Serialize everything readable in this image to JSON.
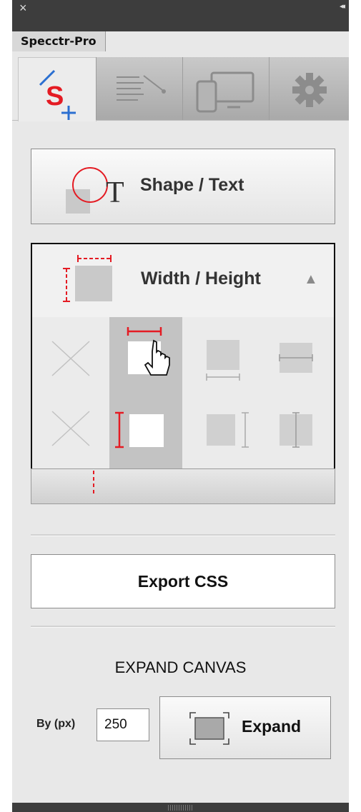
{
  "window": {
    "close_glyph": "×",
    "collapse_glyph": "◂◂"
  },
  "panel": {
    "tab_title": "Specctr-Pro"
  },
  "tabs": [
    {
      "name": "specs",
      "icon": "specctr-logo-icon",
      "active": true
    },
    {
      "name": "notes",
      "icon": "notes-callout-icon",
      "active": false
    },
    {
      "name": "devices",
      "icon": "responsive-devices-icon",
      "active": false
    },
    {
      "name": "settings",
      "icon": "gear-icon",
      "active": false
    }
  ],
  "shape_text": {
    "label": "Shape / Text",
    "icon": "shape-text-icon"
  },
  "width_height": {
    "label": "Width / Height",
    "toggle": "▲",
    "options": [
      {
        "row": 1,
        "col": 1,
        "icon": "none-x-icon",
        "selected": false
      },
      {
        "row": 1,
        "col": 2,
        "icon": "width-top-icon",
        "selected": true
      },
      {
        "row": 1,
        "col": 3,
        "icon": "width-bottom-icon",
        "selected": false
      },
      {
        "row": 1,
        "col": 4,
        "icon": "width-middle-icon",
        "selected": false
      },
      {
        "row": 2,
        "col": 1,
        "icon": "none-x-icon",
        "selected": false
      },
      {
        "row": 2,
        "col": 2,
        "icon": "height-left-icon",
        "selected": true
      },
      {
        "row": 2,
        "col": 3,
        "icon": "height-right-icon",
        "selected": false
      },
      {
        "row": 2,
        "col": 4,
        "icon": "height-center-icon",
        "selected": false
      }
    ]
  },
  "export": {
    "label": "Export CSS"
  },
  "expand_canvas": {
    "heading": "EXPAND CANVAS",
    "by_label": "By (px)",
    "value": "250",
    "button_label": "Expand"
  },
  "colors": {
    "accent": "#e41b23",
    "selected_bg": "#c3c3c3",
    "chrome_dark": "#3d3d3d",
    "panel_bg": "#e8e8e8"
  }
}
